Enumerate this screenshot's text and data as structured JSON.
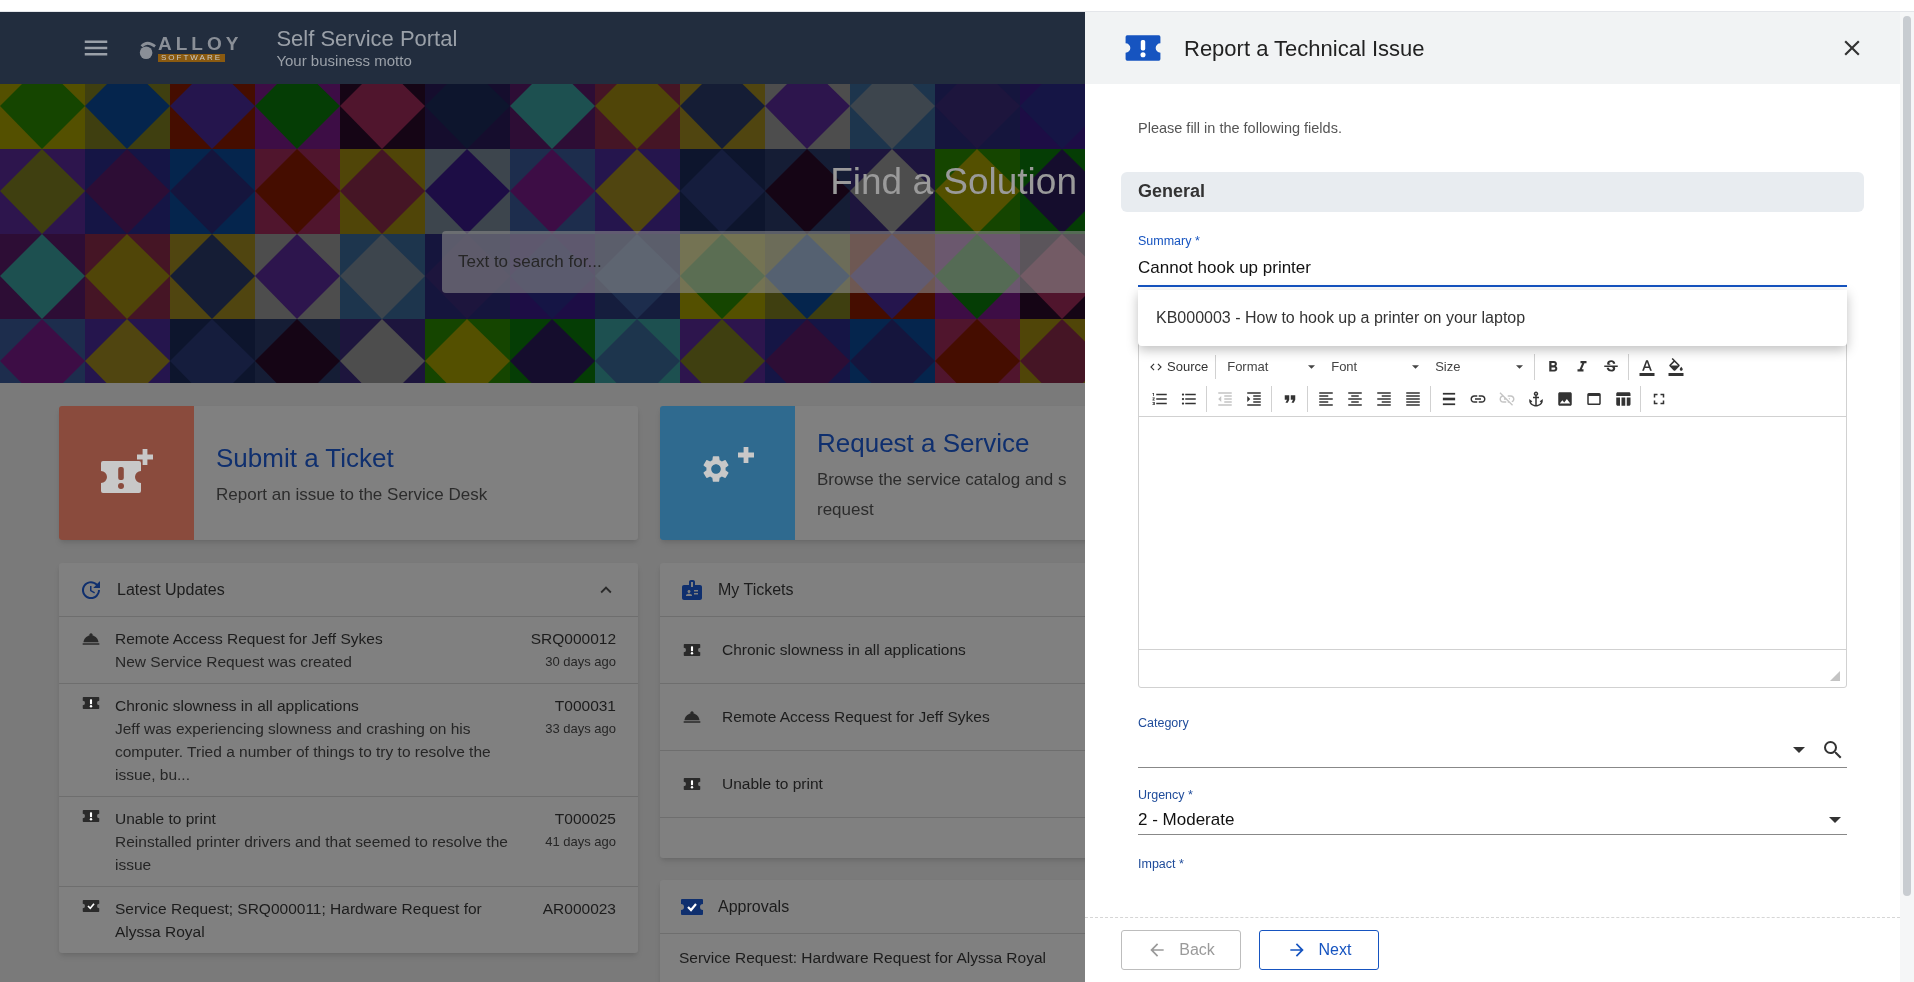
{
  "header": {
    "logo_text": "ALLOY",
    "logo_subtext": "SOFTWARE",
    "title": "Self Service Portal",
    "motto": "Your business motto"
  },
  "hero": {
    "title": "Find a Solution",
    "search_placeholder": "Text to search for..."
  },
  "action_cards": [
    {
      "kind": "ticket",
      "title": "Submit a Ticket",
      "description": "Report an issue to the Service Desk",
      "color": "#8a4b3d"
    },
    {
      "kind": "service",
      "title": "Request a Service",
      "description": "Browse the service catalog and s",
      "description_2": "request",
      "color": "#2f6a8f"
    }
  ],
  "latest_updates": {
    "title": "Latest Updates",
    "expanded": true,
    "items": [
      {
        "kind": "request",
        "title": "Remote Access Request for Jeff Sykes",
        "description": "New Service Request was created",
        "id": "SRQ000012",
        "age": "30 days ago"
      },
      {
        "kind": "ticket",
        "title": "Chronic slowness in all applications",
        "description": "Jeff was experiencing slowness and crashing on his computer. Tried a number of things to try to resolve the issue, bu...",
        "id": "T000031",
        "age": "33 days ago"
      },
      {
        "kind": "ticket",
        "title": "Unable to print",
        "description": "Reinstalled printer drivers and that seemed to resolve the issue",
        "id": "T000025",
        "age": "41 days ago"
      },
      {
        "kind": "approval",
        "title": "Service Request; SRQ000011; Hardware Request for Alyssa Royal",
        "id": "AR000023"
      }
    ]
  },
  "my_tickets": {
    "title": "My Tickets",
    "items": [
      {
        "kind": "ticket",
        "title": "Chronic slowness in all applications"
      },
      {
        "kind": "request",
        "title": "Remote Access Request for Jeff Sykes"
      },
      {
        "kind": "ticket",
        "title": "Unable to print"
      }
    ]
  },
  "approvals": {
    "title": "Approvals",
    "items": [
      {
        "title": "Service Request: Hardware Request for Alyssa Royal"
      }
    ]
  },
  "dialog": {
    "title": "Report a Technical Issue",
    "intro": "Please fill in the following fields.",
    "section": "General",
    "summary": {
      "label": "Summary *",
      "value": "Cannot hook up printer",
      "focused": true
    },
    "suggestions": [
      "KB000003 - How to hook up a printer on your laptop"
    ],
    "toolbar": [
      [
        [
          {
            "kind": "source",
            "label": "Source",
            "disabled": false
          }
        ],
        [
          {
            "kind": "format",
            "label": "Format",
            "disabled": false
          },
          {
            "kind": "font",
            "label": "Font",
            "disabled": false
          },
          {
            "kind": "size",
            "label": "Size",
            "disabled": false
          }
        ],
        [
          {
            "kind": "bold",
            "disabled": false
          },
          {
            "kind": "italic",
            "disabled": false
          },
          {
            "kind": "strike",
            "disabled": false
          }
        ],
        [
          {
            "kind": "text_color",
            "disabled": false
          },
          {
            "kind": "bg_color",
            "disabled": false
          }
        ]
      ],
      [
        [
          {
            "kind": "numbered_list",
            "disabled": false
          },
          {
            "kind": "bulleted_list",
            "disabled": false
          }
        ],
        [
          {
            "kind": "outdent",
            "disabled": true
          },
          {
            "kind": "indent",
            "disabled": false
          }
        ],
        [
          {
            "kind": "blockquote",
            "disabled": false
          }
        ],
        [
          {
            "kind": "align_left",
            "disabled": false
          },
          {
            "kind": "align_center",
            "disabled": false
          },
          {
            "kind": "align_right",
            "disabled": false
          },
          {
            "kind": "justify",
            "disabled": false
          }
        ],
        [
          {
            "kind": "horizontal_rule",
            "disabled": false
          },
          {
            "kind": "link",
            "disabled": false
          },
          {
            "kind": "unlink",
            "disabled": true
          },
          {
            "kind": "anchor",
            "disabled": false
          },
          {
            "kind": "image",
            "disabled": false
          },
          {
            "kind": "iframe",
            "disabled": false
          },
          {
            "kind": "table",
            "disabled": false
          }
        ],
        [
          {
            "kind": "maximize",
            "disabled": false
          }
        ]
      ]
    ],
    "fields": [
      {
        "kind": "lookup",
        "label": "Category"
      },
      {
        "kind": "select",
        "label": "Urgency *",
        "value": "2 - Moderate"
      },
      {
        "kind": "label",
        "label": "Impact *"
      }
    ],
    "buttons": [
      {
        "kind": "back",
        "label": "Back",
        "disabled": true
      },
      {
        "kind": "next",
        "label": "Next",
        "disabled": false
      }
    ]
  }
}
